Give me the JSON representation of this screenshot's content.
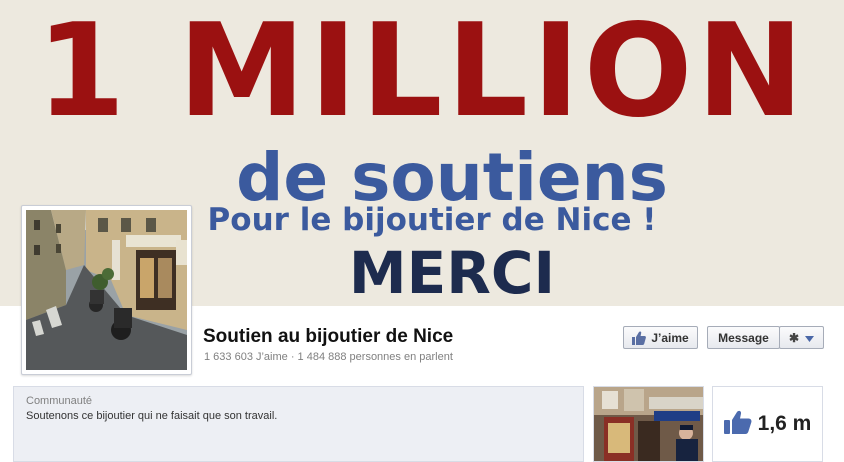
{
  "cover": {
    "line1": "1 MILLION",
    "line2": "de soutiens",
    "line3": "Pour le bijoutier de Nice !",
    "line4": "MERCI"
  },
  "page": {
    "name": "Soutien au bijoutier de Nice",
    "stats": "1 633 603 J’aime · 1 484 888 personnes en parlent"
  },
  "actions": {
    "like_label": "J’aime",
    "message_label": "Message",
    "gear_icon": "gear-icon",
    "caret_icon": "chevron-down-icon"
  },
  "about": {
    "category": "Communauté",
    "description": "Soutenons ce bijoutier qui ne faisait que son travail."
  },
  "likes_app": {
    "count": "1,6 m",
    "icon": "thumbs-up-icon"
  },
  "colors": {
    "cover_bg": "#ede9df",
    "headline_red": "#9b1111",
    "headline_blue": "#3b5a9e",
    "headline_navy": "#1d2b4e",
    "fb_blue": "#3b5998"
  }
}
